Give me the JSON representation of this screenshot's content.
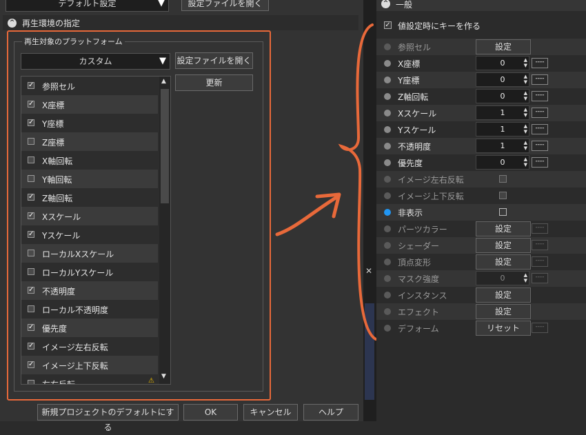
{
  "top": {
    "default_dropdown": "デフォルト設定",
    "open_settings_top": "設定ファイルを開く"
  },
  "section": {
    "title": "再生環境の指定",
    "group_title": "再生対象のプラットフォーム"
  },
  "platform": {
    "selected": "カスタム",
    "open_settings": "設定ファイルを開く",
    "update": "更新"
  },
  "list_items": [
    {
      "label": "参照セル",
      "checked": true
    },
    {
      "label": "X座標",
      "checked": true
    },
    {
      "label": "Y座標",
      "checked": true
    },
    {
      "label": "Z座標",
      "checked": false
    },
    {
      "label": "X軸回転",
      "checked": false
    },
    {
      "label": "Y軸回転",
      "checked": false
    },
    {
      "label": "Z軸回転",
      "checked": true
    },
    {
      "label": "Xスケール",
      "checked": true
    },
    {
      "label": "Yスケール",
      "checked": true
    },
    {
      "label": "ローカルXスケール",
      "checked": false
    },
    {
      "label": "ローカルYスケール",
      "checked": false
    },
    {
      "label": "不透明度",
      "checked": true
    },
    {
      "label": "ローカル不透明度",
      "checked": false
    },
    {
      "label": "優先度",
      "checked": true
    },
    {
      "label": "イメージ左右反転",
      "checked": true
    },
    {
      "label": "イメージ上下反転",
      "checked": true
    },
    {
      "label": "左右反転",
      "checked": false
    }
  ],
  "bottom": {
    "set_default": "新規プロジェクトのデフォルトにする",
    "ok": "OK",
    "cancel": "キャンセル",
    "help": "ヘルプ"
  },
  "panel": {
    "header": "一般",
    "key_checkbox_label": "値設定時にキーを作る",
    "rows": [
      {
        "label": "参照セル",
        "type": "button",
        "value": "設定",
        "dim": true
      },
      {
        "label": "X座標",
        "type": "number",
        "value": "0"
      },
      {
        "label": "Y座標",
        "type": "number",
        "value": "0"
      },
      {
        "label": "Z軸回転",
        "type": "number",
        "value": "0"
      },
      {
        "label": "Xスケール",
        "type": "number",
        "value": "1"
      },
      {
        "label": "Yスケール",
        "type": "number",
        "value": "1"
      },
      {
        "label": "不透明度",
        "type": "number",
        "value": "1"
      },
      {
        "label": "優先度",
        "type": "number",
        "value": "0"
      },
      {
        "label": "イメージ左右反転",
        "type": "check",
        "dim": true
      },
      {
        "label": "イメージ上下反転",
        "type": "check",
        "dim": true
      },
      {
        "label": "非表示",
        "type": "check",
        "blue": true
      },
      {
        "label": "パーツカラー",
        "type": "button",
        "value": "設定",
        "dim": true
      },
      {
        "label": "シェーダー",
        "type": "button",
        "value": "設定",
        "dim": true
      },
      {
        "label": "頂点変形",
        "type": "button",
        "value": "設定",
        "dim": true
      },
      {
        "label": "マスク強度",
        "type": "number",
        "value": "0",
        "dim": true
      },
      {
        "label": "インスタンス",
        "type": "button",
        "value": "設定",
        "dim": true
      },
      {
        "label": "エフェクト",
        "type": "button",
        "value": "設定",
        "dim": true
      },
      {
        "label": "デフォーム",
        "type": "button",
        "value": "リセット",
        "dim": true
      }
    ],
    "dash_label": "----"
  },
  "annotation": {
    "color": "#e8693a"
  },
  "colors": {
    "accent_blue": "#2196f3",
    "highlight": "#e8693a"
  }
}
